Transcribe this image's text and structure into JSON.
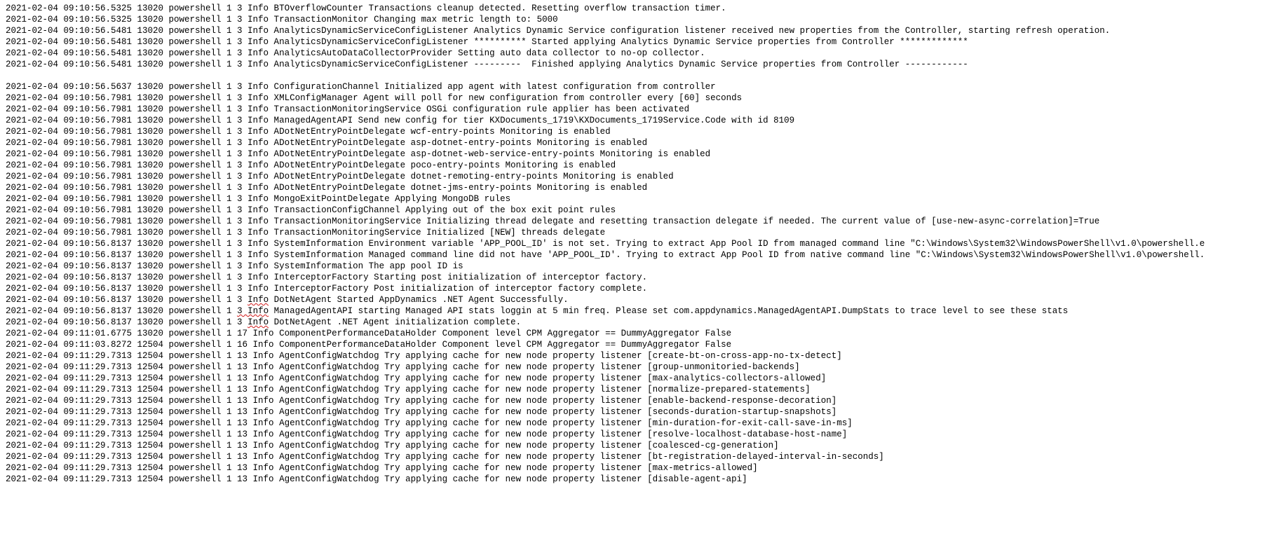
{
  "log": {
    "lines": [
      {
        "k": "text",
        "p": "2021-02-04 09:10:56.5325 13020 powershell 1 3 Info BTOverflowCounter Transactions cleanup detected. Resetting overflow transaction timer."
      },
      {
        "k": "text",
        "p": "2021-02-04 09:10:56.5325 13020 powershell 1 3 Info TransactionMonitor Changing max metric length to: 5000"
      },
      {
        "k": "text",
        "p": "2021-02-04 09:10:56.5481 13020 powershell 1 3 Info AnalyticsDynamicServiceConfigListener Analytics Dynamic Service configuration listener received new properties from the Controller, starting refresh operation."
      },
      {
        "k": "text",
        "p": "2021-02-04 09:10:56.5481 13020 powershell 1 3 Info AnalyticsDynamicServiceConfigListener ********** Started applying Analytics Dynamic Service properties from Controller *************"
      },
      {
        "k": "text",
        "p": "2021-02-04 09:10:56.5481 13020 powershell 1 3 Info AnalyticsAutoDataCollectorProvider Setting auto data collector to no-op collector."
      },
      {
        "k": "text",
        "p": "2021-02-04 09:10:56.5481 13020 powershell 1 3 Info AnalyticsDynamicServiceConfigListener ---------  Finished applying Analytics Dynamic Service properties from Controller ------------"
      },
      {
        "k": "blank"
      },
      {
        "k": "text",
        "p": "2021-02-04 09:10:56.5637 13020 powershell 1 3 Info ConfigurationChannel Initialized app agent with latest configuration from controller"
      },
      {
        "k": "text",
        "p": "2021-02-04 09:10:56.7981 13020 powershell 1 3 Info XMLConfigManager Agent will poll for new configuration from controller every [60] seconds"
      },
      {
        "k": "text",
        "p": "2021-02-04 09:10:56.7981 13020 powershell 1 3 Info TransactionMonitoringService OSGi configuration rule applier has been activated"
      },
      {
        "k": "text",
        "p": "2021-02-04 09:10:56.7981 13020 powershell 1 3 Info ManagedAgentAPI Send new config for tier KXDocuments_1719\\KXDocuments_1719Service.Code with id 8109"
      },
      {
        "k": "text",
        "p": "2021-02-04 09:10:56.7981 13020 powershell 1 3 Info ADotNetEntryPointDelegate wcf-entry-points Monitoring is enabled"
      },
      {
        "k": "text",
        "p": "2021-02-04 09:10:56.7981 13020 powershell 1 3 Info ADotNetEntryPointDelegate asp-dotnet-entry-points Monitoring is enabled"
      },
      {
        "k": "text",
        "p": "2021-02-04 09:10:56.7981 13020 powershell 1 3 Info ADotNetEntryPointDelegate asp-dotnet-web-service-entry-points Monitoring is enabled"
      },
      {
        "k": "text",
        "p": "2021-02-04 09:10:56.7981 13020 powershell 1 3 Info ADotNetEntryPointDelegate poco-entry-points Monitoring is enabled"
      },
      {
        "k": "text",
        "p": "2021-02-04 09:10:56.7981 13020 powershell 1 3 Info ADotNetEntryPointDelegate dotnet-remoting-entry-points Monitoring is enabled"
      },
      {
        "k": "text",
        "p": "2021-02-04 09:10:56.7981 13020 powershell 1 3 Info ADotNetEntryPointDelegate dotnet-jms-entry-points Monitoring is enabled"
      },
      {
        "k": "text",
        "p": "2021-02-04 09:10:56.7981 13020 powershell 1 3 Info MongoExitPointDelegate Applying MongoDB rules"
      },
      {
        "k": "text",
        "p": "2021-02-04 09:10:56.7981 13020 powershell 1 3 Info TransactionConfigChannel Applying out of the box exit point rules"
      },
      {
        "k": "text",
        "p": "2021-02-04 09:10:56.7981 13020 powershell 1 3 Info TransactionMonitoringService Initializing thread delegate and resetting transaction delegate if needed. The current value of [use-new-async-correlation]=True"
      },
      {
        "k": "text",
        "p": "2021-02-04 09:10:56.7981 13020 powershell 1 3 Info TransactionMonitoringService Initialized [NEW] threads delegate"
      },
      {
        "k": "text",
        "p": "2021-02-04 09:10:56.8137 13020 powershell 1 3 Info SystemInformation Environment variable 'APP_POOL_ID' is not set. Trying to extract App Pool ID from managed command line \"C:\\Windows\\System32\\WindowsPowerShell\\v1.0\\powershell.e"
      },
      {
        "k": "text",
        "p": "2021-02-04 09:10:56.8137 13020 powershell 1 3 Info SystemInformation Managed command line did not have 'APP_POOL_ID'. Trying to extract App Pool ID from native command line \"C:\\Windows\\System32\\WindowsPowerShell\\v1.0\\powershell."
      },
      {
        "k": "text",
        "p": "2021-02-04 09:10:56.8137 13020 powershell 1 3 Info SystemInformation The app pool ID is"
      },
      {
        "k": "text",
        "p": "2021-02-04 09:10:56.8137 13020 powershell 1 3 Info InterceptorFactory Starting post initialization of interceptor factory."
      },
      {
        "k": "text",
        "p": "2021-02-04 09:10:56.8137 13020 powershell 1 3 Info InterceptorFactory Post initialization of interceptor factory complete."
      },
      {
        "k": "err",
        "p1": "2021-02-04 09:10:56.8137 13020 powershell 1 3 ",
        "p2": "Info",
        "p3": " DotNetAgent Started AppDynamics .NET Agent Successfully."
      },
      {
        "k": "err",
        "p1": "2021-02-04 09:10:56.8137 13020 powershell 1 ",
        "p2": "3 Info",
        "p3": " ManagedAgentAPI starting Managed API stats loggin at 5 min freq. Please set com.appdynamics.ManagedAgentAPI.DumpStats to trace level to see these stats"
      },
      {
        "k": "err",
        "p1": "2021-02-04 09:10:56.8137 13020 powershell 1 3 ",
        "p2": "Info",
        "p3": " DotNetAgent .NET Agent initialization complete."
      },
      {
        "k": "text",
        "p": "2021-02-04 09:11:01.6775 13020 powershell 1 17 Info ComponentPerformanceDataHolder Component level CPM Aggregator == DummyAggregator False"
      },
      {
        "k": "text",
        "p": "2021-02-04 09:11:03.8272 12504 powershell 1 16 Info ComponentPerformanceDataHolder Component level CPM Aggregator == DummyAggregator False"
      },
      {
        "k": "text",
        "p": "2021-02-04 09:11:29.7313 12504 powershell 1 13 Info AgentConfigWatchdog Try applying cache for new node property listener [create-bt-on-cross-app-no-tx-detect]"
      },
      {
        "k": "text",
        "p": "2021-02-04 09:11:29.7313 12504 powershell 1 13 Info AgentConfigWatchdog Try applying cache for new node property listener [group-unmonitoried-backends]"
      },
      {
        "k": "text",
        "p": "2021-02-04 09:11:29.7313 12504 powershell 1 13 Info AgentConfigWatchdog Try applying cache for new node property listener [max-analytics-collectors-allowed]"
      },
      {
        "k": "text",
        "p": "2021-02-04 09:11:29.7313 12504 powershell 1 13 Info AgentConfigWatchdog Try applying cache for new node property listener [normalize-prepared-statements]"
      },
      {
        "k": "text",
        "p": "2021-02-04 09:11:29.7313 12504 powershell 1 13 Info AgentConfigWatchdog Try applying cache for new node property listener [enable-backend-response-decoration]"
      },
      {
        "k": "text",
        "p": "2021-02-04 09:11:29.7313 12504 powershell 1 13 Info AgentConfigWatchdog Try applying cache for new node property listener [seconds-duration-startup-snapshots]"
      },
      {
        "k": "text",
        "p": "2021-02-04 09:11:29.7313 12504 powershell 1 13 Info AgentConfigWatchdog Try applying cache for new node property listener [min-duration-for-exit-call-save-in-ms]"
      },
      {
        "k": "text",
        "p": "2021-02-04 09:11:29.7313 12504 powershell 1 13 Info AgentConfigWatchdog Try applying cache for new node property listener [resolve-localhost-database-host-name]"
      },
      {
        "k": "text",
        "p": "2021-02-04 09:11:29.7313 12504 powershell 1 13 Info AgentConfigWatchdog Try applying cache for new node property listener [coalesced-cg-generation]"
      },
      {
        "k": "text",
        "p": "2021-02-04 09:11:29.7313 12504 powershell 1 13 Info AgentConfigWatchdog Try applying cache for new node property listener [bt-registration-delayed-interval-in-seconds]"
      },
      {
        "k": "text",
        "p": "2021-02-04 09:11:29.7313 12504 powershell 1 13 Info AgentConfigWatchdog Try applying cache for new node property listener [max-metrics-allowed]"
      },
      {
        "k": "text",
        "p": "2021-02-04 09:11:29.7313 12504 powershell 1 13 Info AgentConfigWatchdog Try applying cache for new node property listener [disable-agent-api]"
      }
    ]
  }
}
